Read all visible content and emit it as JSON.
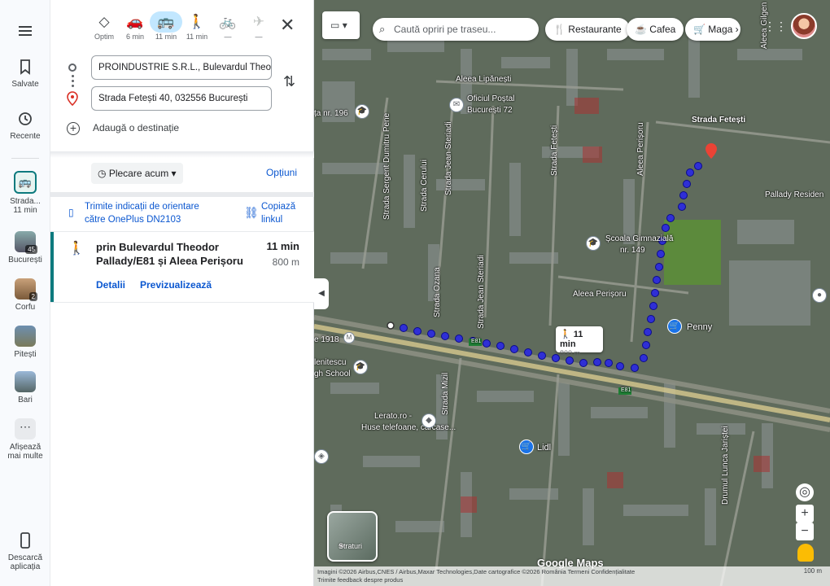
{
  "rail": {
    "menu_icon": "hamburger-menu-icon",
    "saved_label": "Salvate",
    "recent_label": "Recente",
    "active_trip_label": "Strada...",
    "active_trip_sub": "11 min",
    "recent_places": [
      {
        "label": "București",
        "badge": "45"
      },
      {
        "label": "Corfu",
        "badge": "2"
      },
      {
        "label": "Pitești",
        "badge": ""
      },
      {
        "label": "Bari",
        "badge": ""
      }
    ],
    "more_label_1": "Afișează",
    "more_label_2": "mai multe",
    "download_label_1": "Descarcă",
    "download_label_2": "aplicația"
  },
  "modes": [
    {
      "name": "best",
      "label": "Optim",
      "icon": "◇"
    },
    {
      "name": "car",
      "label": "6 min",
      "icon": "🚗"
    },
    {
      "name": "transit",
      "label": "11 min",
      "icon": "🚌"
    },
    {
      "name": "walk",
      "label": "11 min",
      "icon": "🚶"
    },
    {
      "name": "bike",
      "label": "—",
      "icon": "🚲"
    },
    {
      "name": "flight",
      "label": "—",
      "icon": "✈"
    }
  ],
  "origin": "PROINDUSTRIE S.R.L., Bulevardul Theodor Pallady",
  "destination": "Strada Fetești 40, 032556 București",
  "add_destination": "Adaugă o destinație",
  "depart_label": "Plecare acum",
  "options_label": "Opțiuni",
  "send_text_1": "Trimite indicații de orientare",
  "send_text_2": "către OnePlus DN2103",
  "copy_text_1": "Copiază",
  "copy_text_2": "linkul",
  "route": {
    "name_1": "prin Bulevardul Theodor",
    "name_2": "Pallady/E81 și Aleea Perișoru",
    "time": "11 min",
    "distance": "800 m",
    "details": "Detalii",
    "preview": "Previzualizează"
  },
  "map": {
    "search_placeholder": "Caută opriri pe traseu...",
    "chips": [
      "Restaurante",
      "Cafea",
      "Maga"
    ],
    "bubble_time": "11 min",
    "bubble_dist": "800 m",
    "layers_label": "Straturi",
    "logo": "Google Maps",
    "attribution_1": "Imagini ©2026 Airbus,CNES / Airbus,Maxar Technologies,Date cartografice ©2026   România   Termeni   Confidențialitate",
    "attribution_2": "Trimite feedback despre produs",
    "scale": "100 m",
    "labels": {
      "aleea_lipanesti": "Aleea Lipănești",
      "oficiul_postal_1": "Oficiul Poștal",
      "oficiul_postal_2": "București 72",
      "strada_fetesti": "Strada Fetești",
      "pallady_res": "Pallady Residen",
      "scoala_1": "Școala Gimnazială",
      "scoala_2": "nr. 149",
      "aleea_perisoru": "Aleea Perișoru",
      "penny": "Penny",
      "lidl": "Lidl",
      "lerato_1": "Lerato.ro -",
      "lerato_2": "Huse telefoane, carcase...",
      "enitescu_1": "lenitescu",
      "enitescu_2": "gh School",
      "stop_196": "ța nr. 196",
      "tram_1918": "e 1918",
      "e81": "E81",
      "str_sergent": "Strada Sergent Dumitru Pene",
      "str_cerului": "Strada Cerului",
      "str_jean_1": "Strada Jean Steriadi",
      "str_fetesti_v": "Strada Fetești",
      "str_ozana": "Strada Ozana",
      "str_jean_2": "Strada Jean Steriadi",
      "str_perisoru_v": "Aleea Perișoru",
      "str_mizil": "Strada Mizil",
      "str_lunca": "Drumul Lunca Jariștei",
      "aleea_gilgen": "Aleea Gilgen"
    }
  }
}
